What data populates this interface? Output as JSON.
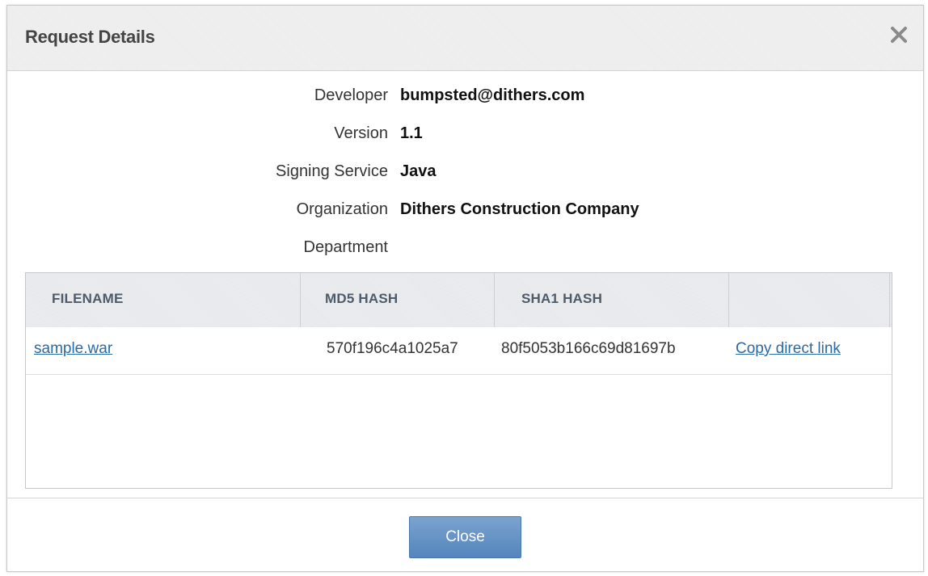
{
  "dialog": {
    "title": "Request Details",
    "close_icon": "close-icon"
  },
  "details": [
    {
      "label": "Developer",
      "value": "bumpsted@dithers.com"
    },
    {
      "label": "Version",
      "value": "1.1"
    },
    {
      "label": "Signing Service",
      "value": "Java"
    },
    {
      "label": "Organization",
      "value": "Dithers Construction Company"
    },
    {
      "label": "Department",
      "value": ""
    }
  ],
  "table": {
    "columns": [
      "FILENAME",
      "MD5 HASH",
      "SHA1 HASH",
      ""
    ],
    "rows": [
      {
        "filename": "sample.war",
        "md5": "570f196c4a1025a7",
        "sha1": "80f5053b166c69d81697b",
        "action": "Copy direct link"
      }
    ]
  },
  "footer": {
    "close_label": "Close"
  },
  "colors": {
    "link": "#2a6aa5",
    "button": "#5f8fc4",
    "header_text": "#4d5b6b"
  }
}
